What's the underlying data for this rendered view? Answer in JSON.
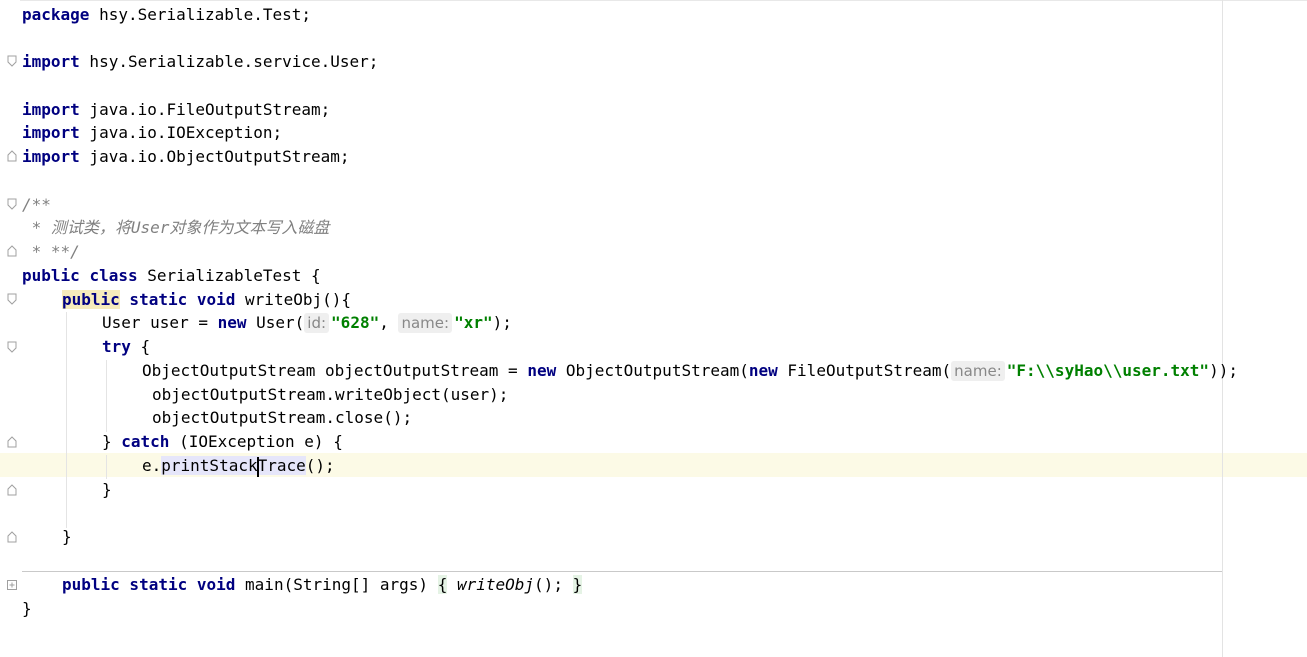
{
  "editor": {
    "package_kw": "package",
    "package_name": " hsy.Serializable.Test;",
    "import_kw": "import",
    "imports": [
      " hsy.Serializable.service.User;",
      " java.io.FileOutputStream;",
      " java.io.IOException;",
      " java.io.ObjectOutputStream;"
    ],
    "comment_lines": [
      "/**",
      " * 测试类，将User对象作为文本写入磁盘",
      " * **/"
    ],
    "class_decl": {
      "public": "public",
      "class": "class",
      "name": " SerializableTest {"
    },
    "method_decl": {
      "public": "public",
      "static": " static",
      "void": " void",
      "rest": " writeObj(){"
    },
    "user_line": {
      "pre": "User user = ",
      "new": "new",
      "ctor": " User(",
      "hint_id": "id:",
      "val_id": "\"628\"",
      "comma": ", ",
      "hint_name": "name:",
      "val_name": "\"xr\"",
      "end": ");"
    },
    "try_line": {
      "try": "try",
      "rest": " {"
    },
    "oos_line": {
      "pre": "ObjectOutputStream objectOutputStream = ",
      "new1": "new",
      "mid": " ObjectOutputStream(",
      "new2": "new",
      "fos": " FileOutputStream(",
      "hint_name": "name:",
      "path": "\"F:\\\\syHao\\\\user.txt\"",
      "end": "));"
    },
    "write_line": "objectOutputStream.writeObject(user);",
    "close_line": "objectOutputStream.close();",
    "catch_line": {
      "pre": "} ",
      "catch": "catch",
      "rest": " (IOException e) {"
    },
    "trace_line": {
      "pre": "e.",
      "call_a": "printStack",
      "call_b": "Trace",
      "end": "();"
    },
    "close_brace": "}",
    "main_line": {
      "public": "public",
      "static": " static",
      "void": " void",
      "sig": " main(String[] args) ",
      "lbrace": "{",
      "call": "writeObj",
      "call_end": "(); ",
      "rbrace": "}"
    }
  },
  "colors": {
    "keyword": "#000080",
    "string": "#008000",
    "comment": "#808080",
    "current_line": "#fcfae6"
  }
}
